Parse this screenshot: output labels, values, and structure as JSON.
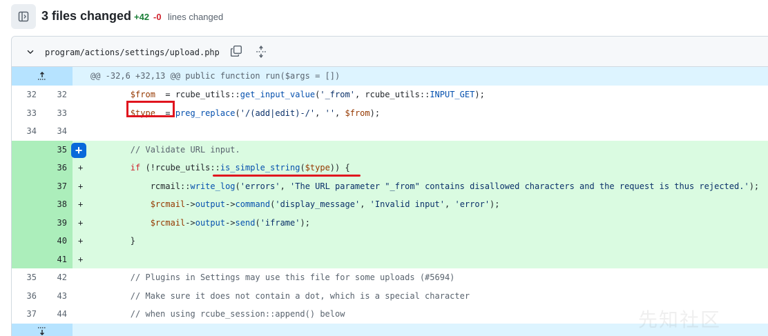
{
  "summary": {
    "files_changed": "3 files changed",
    "additions": "+42",
    "deletions": "-0",
    "lines_changed": "lines changed"
  },
  "file": {
    "path": "program/actions/settings/upload.php"
  },
  "hunk_header": "@@ -32,6 +32,13 @@ public function run($args = [])",
  "lines": [
    {
      "old": "32",
      "new": "32",
      "marker": "",
      "type": "ctx"
    },
    {
      "old": "33",
      "new": "33",
      "marker": "",
      "type": "ctx"
    },
    {
      "old": "34",
      "new": "34",
      "marker": "",
      "type": "ctx"
    },
    {
      "old": "",
      "new": "35",
      "marker": "+",
      "type": "add"
    },
    {
      "old": "",
      "new": "36",
      "marker": "+",
      "type": "add"
    },
    {
      "old": "",
      "new": "37",
      "marker": "+",
      "type": "add"
    },
    {
      "old": "",
      "new": "38",
      "marker": "+",
      "type": "add"
    },
    {
      "old": "",
      "new": "39",
      "marker": "+",
      "type": "add"
    },
    {
      "old": "",
      "new": "40",
      "marker": "+",
      "type": "add"
    },
    {
      "old": "",
      "new": "41",
      "marker": "+",
      "type": "add"
    },
    {
      "old": "35",
      "new": "42",
      "marker": "",
      "type": "ctx"
    },
    {
      "old": "36",
      "new": "43",
      "marker": "",
      "type": "ctx"
    },
    {
      "old": "37",
      "new": "44",
      "marker": "",
      "type": "ctx"
    }
  ],
  "code": {
    "l32": {
      "a": "        ",
      "b": "$from",
      "c": "  = rcube_utils::",
      "d": "get_input_value",
      "e": "(",
      "f": "'_from'",
      "g": ", rcube_utils::",
      "h": "INPUT_GET",
      "i": ");"
    },
    "l33": {
      "a": "        ",
      "b": "$type",
      "c": "  = ",
      "d": "preg_replace",
      "e": "(",
      "f": "'/(add|edit)-/'",
      "g": ", ",
      "h": "''",
      "i": ", ",
      "j": "$from",
      "k": ");"
    },
    "l35": {
      "a": "        ",
      "b": "// Validate URL input."
    },
    "l36": {
      "a": "        ",
      "b": "if",
      "c": " (!rcube_utils::",
      "d": "is_simple_string",
      "e": "(",
      "f": "$type",
      "g": ")) {"
    },
    "l37": {
      "a": "            rcmail::",
      "b": "write_log",
      "c": "(",
      "d": "'errors'",
      "e": ", ",
      "f": "'The URL parameter \"_from\" contains disallowed characters and the request is thus rejected.'",
      "g": ");"
    },
    "l38": {
      "a": "            ",
      "b": "$rcmail",
      "c": "->",
      "d": "output",
      "e": "->",
      "f": "command",
      "g": "(",
      "h": "'display_message'",
      "i": ", ",
      "j": "'Invalid input'",
      "k": ", ",
      "l": "'error'",
      "m": ");"
    },
    "l39": {
      "a": "            ",
      "b": "$rcmail",
      "c": "->",
      "d": "output",
      "e": "->",
      "f": "send",
      "g": "(",
      "h": "'iframe'",
      "i": ");"
    },
    "l40": {
      "a": "        }"
    },
    "l42": {
      "a": "        ",
      "b": "// Plugins in Settings may use this file for some uploads (#5694)"
    },
    "l43": {
      "a": "        ",
      "b": "// Make sure it does not contain a dot, which is a special character"
    },
    "l44": {
      "a": "        ",
      "b": "// when using rcube_session::append() below"
    }
  },
  "add_comment_label": "+",
  "watermark": "先知社区",
  "colors": {
    "addition_bg": "#dafbe1",
    "addition_gutter": "#aceebb",
    "hunk_bg": "#ddf4ff",
    "hunk_gutter": "#b6e3ff",
    "annotation_red": "#e0141e",
    "accent_blue": "#0969da"
  }
}
